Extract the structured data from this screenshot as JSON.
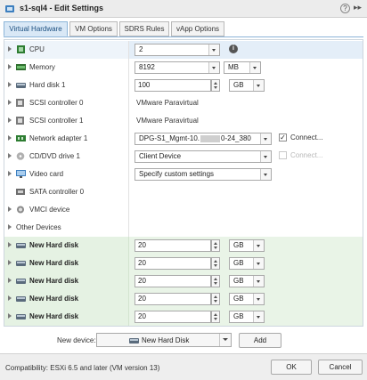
{
  "window": {
    "title": "s1-sql4 - Edit Settings",
    "help_icon": "question-icon",
    "expand_icon": "double-chevron-icon"
  },
  "tabs": [
    {
      "label": "Virtual Hardware",
      "active": true
    },
    {
      "label": "VM Options",
      "active": false
    },
    {
      "label": "SDRS Rules",
      "active": false
    },
    {
      "label": "vApp Options",
      "active": false
    }
  ],
  "hardware": {
    "cpu": {
      "label": "CPU",
      "value": "2"
    },
    "memory": {
      "label": "Memory",
      "value": "8192",
      "unit": "MB"
    },
    "hard_disk_1": {
      "label": "Hard disk 1",
      "value": "100",
      "unit": "GB"
    },
    "scsi0": {
      "label": "SCSI controller 0",
      "value": "VMware Paravirtual"
    },
    "scsi1": {
      "label": "SCSI controller 1",
      "value": "VMware Paravirtual"
    },
    "net1": {
      "label": "Network adapter 1",
      "value_start": "DPG-S1_Mgmt-10.",
      "value_end": "0-24_380",
      "connect_label": "Connect...",
      "connected": true
    },
    "cd1": {
      "label": "CD/DVD drive 1",
      "value": "Client Device",
      "connect_label": "Connect...",
      "connected": false
    },
    "video": {
      "label": "Video card",
      "value": "Specify custom settings"
    },
    "sata0": {
      "label": "SATA controller 0"
    },
    "vmci": {
      "label": "VMCI device"
    },
    "other": {
      "label": "Other Devices"
    },
    "new_disks": [
      {
        "label": "New Hard disk",
        "value": "20",
        "unit": "GB"
      },
      {
        "label": "New Hard disk",
        "value": "20",
        "unit": "GB"
      },
      {
        "label": "New Hard disk",
        "value": "20",
        "unit": "GB"
      },
      {
        "label": "New Hard disk",
        "value": "20",
        "unit": "GB"
      },
      {
        "label": "New Hard disk",
        "value": "20",
        "unit": "GB"
      }
    ]
  },
  "new_device": {
    "label": "New device:",
    "selected": "New Hard Disk",
    "add_label": "Add"
  },
  "footer": {
    "compatibility": "Compatibility: ESXi 6.5 and later (VM version 13)",
    "ok_label": "OK",
    "cancel_label": "Cancel"
  },
  "colors": {
    "accent": "#1b4f80",
    "tab_active_bg": "#d9e8f6",
    "new_row_bg": "#e5f2e3"
  }
}
